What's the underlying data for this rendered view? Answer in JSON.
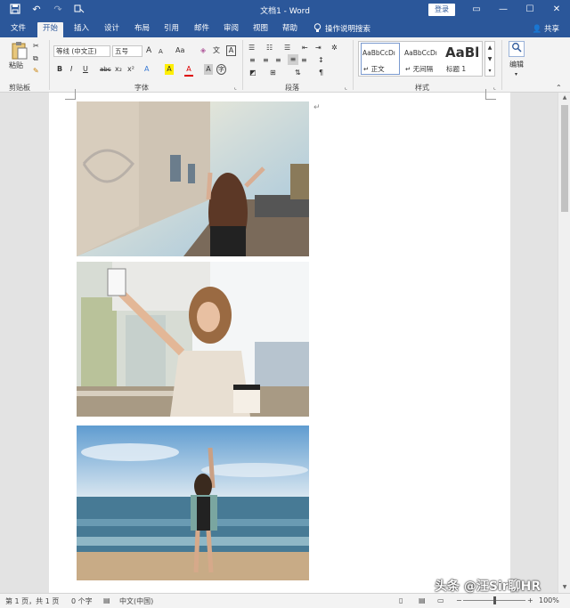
{
  "titlebar": {
    "title": "文档1  -  Word",
    "login_label": "登录",
    "qat": [
      "save-icon",
      "undo-icon",
      "redo-icon",
      "touch-mode-icon"
    ],
    "controls": {
      "restore": "▭",
      "minimize": "—",
      "maximize": "☐",
      "close": "✕"
    }
  },
  "tabs": [
    {
      "label": "文件"
    },
    {
      "label": "开始"
    },
    {
      "label": "插入"
    },
    {
      "label": "设计"
    },
    {
      "label": "布局"
    },
    {
      "label": "引用"
    },
    {
      "label": "邮件"
    },
    {
      "label": "审阅"
    },
    {
      "label": "视图"
    },
    {
      "label": "帮助"
    }
  ],
  "tell_me": "操作说明搜索",
  "share": "共享",
  "ribbon": {
    "clipboard": {
      "paste": "粘贴",
      "label": "剪贴板"
    },
    "font": {
      "name": "等线 (中文正)",
      "size": "五号",
      "label": "字体",
      "aa_label": "Aa",
      "bold": "B",
      "italic": "I",
      "underline": "U",
      "strike": "abc",
      "subscript": "x₂",
      "superscript": "x²",
      "grow": "A",
      "shrink": "A",
      "highlight": "A",
      "font_color": "A",
      "char_shading": "A",
      "enclosed": "字",
      "wen": "文",
      "boxed": "A"
    },
    "paragraph": {
      "label": "段落"
    },
    "styles": {
      "label": "样式",
      "items": [
        {
          "sample": "AaBbCcDı",
          "name": "↵ 正文"
        },
        {
          "sample": "AaBbCcDı",
          "name": "↵ 无间隔"
        },
        {
          "sample": "AaBl",
          "name": "标题 1"
        }
      ]
    },
    "editing": {
      "label": "编辑"
    }
  },
  "document": {
    "paragraph_mark": "↵"
  },
  "status": {
    "page": "第 1 页，共 1 页",
    "words": "0 个字",
    "language": "中文(中国)",
    "zoom": "100%",
    "zoom_minus": "−",
    "zoom_plus": "+"
  },
  "watermark": "头条 @汪Sir聊HR"
}
